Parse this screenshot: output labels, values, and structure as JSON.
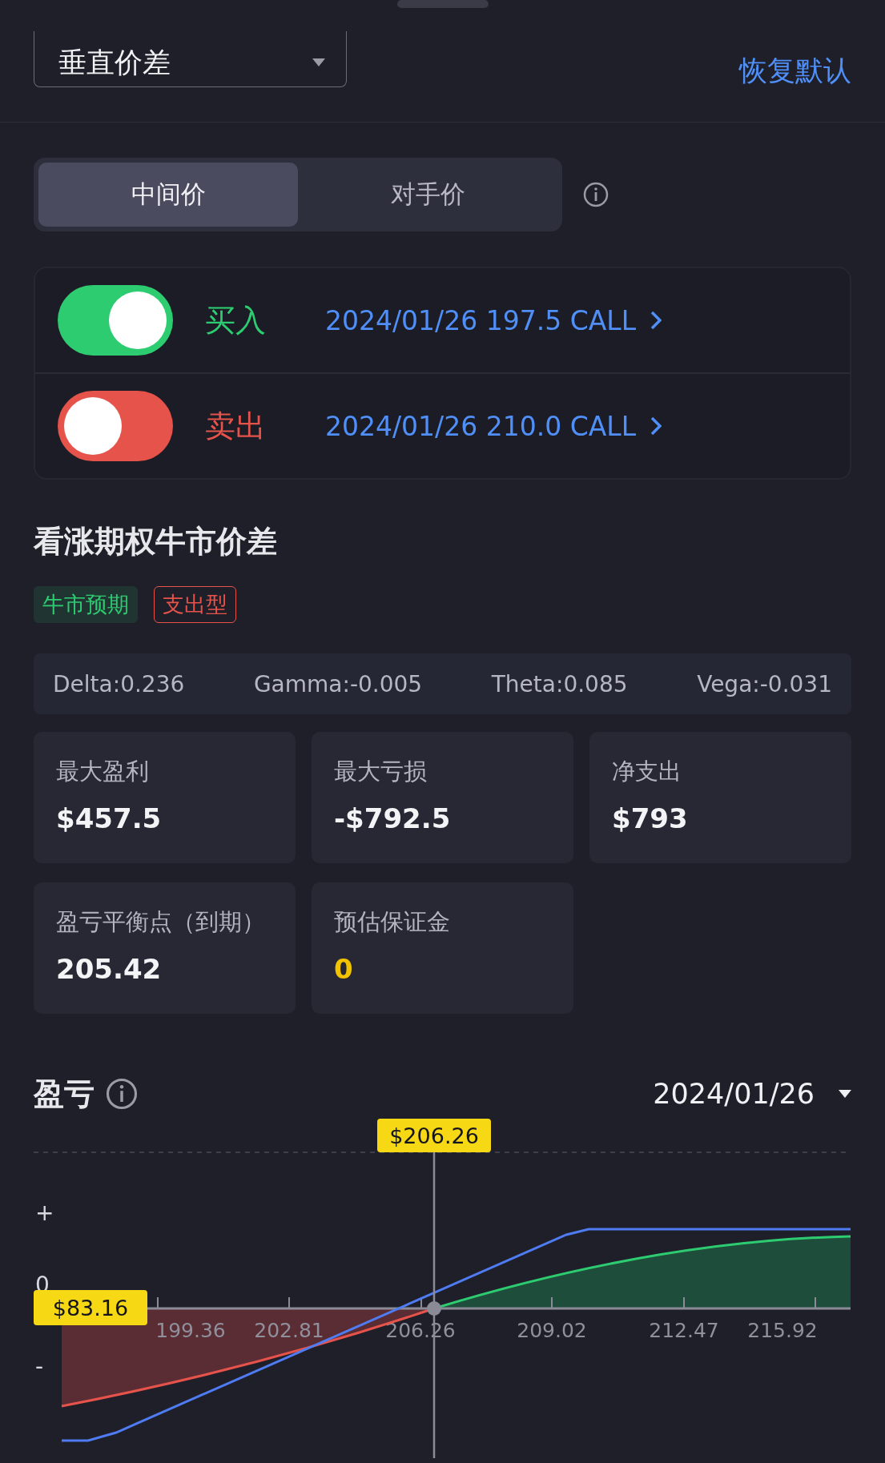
{
  "header": {
    "strategy_select": "垂直价差",
    "reset_link": "恢复默认"
  },
  "price_tabs": [
    {
      "label": "中间价",
      "selected": true
    },
    {
      "label": "对手价",
      "selected": false
    }
  ],
  "legs": [
    {
      "kind": "buy",
      "on": true,
      "action": "买入",
      "contract": "2024/01/26 197.5 CALL"
    },
    {
      "kind": "sell",
      "on": false,
      "action": "卖出",
      "contract": "2024/01/26 210.0 CALL"
    }
  ],
  "strategy": {
    "title": "看涨期权牛市价差",
    "tags": [
      {
        "label": "牛市预期",
        "kind": "filled",
        "color": "#2ecc71"
      },
      {
        "label": "支出型",
        "kind": "outline",
        "color": "#e5534b"
      }
    ]
  },
  "greeks": [
    "Delta:0.236",
    "Gamma:-0.005",
    "Theta:0.085",
    "Vega:-0.031"
  ],
  "metrics": [
    {
      "label": "最大盈利",
      "value": "$457.5",
      "kind": "plain"
    },
    {
      "label": "最大亏损",
      "value": "-$792.5",
      "kind": "plain"
    },
    {
      "label": "净支出",
      "value": "$793",
      "kind": "plain"
    },
    {
      "label": "盈亏平衡点（到期）",
      "value": "205.42",
      "kind": "plain"
    },
    {
      "label": "预估保证金",
      "value": "0",
      "kind": "highlight"
    }
  ],
  "pnl_chart": {
    "title": "盈亏",
    "date_select": "2024/01/26",
    "y_labels": [
      "+",
      "0",
      "-"
    ],
    "x_labels": [
      "199.36",
      "202.81",
      "206.26",
      "209.02",
      "212.47",
      "215.92"
    ],
    "crosshair_label": "$206.26",
    "price_label": "$83.16"
  }
}
